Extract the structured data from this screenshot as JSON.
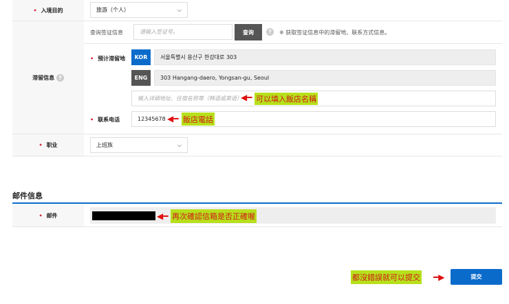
{
  "entry_purpose": {
    "label": "入境目的",
    "value": "旅游（个人）"
  },
  "stay_info": {
    "label": "滞留信息",
    "visa_query": {
      "label": "查询签证信息",
      "placeholder": "请输入签证号。",
      "button": "查询",
      "hint": "※ 获取签证信息中的滞留地、联系方式信息。"
    },
    "address": {
      "label": "预计滞留地",
      "kor_tag": "KOR",
      "kor_value": "서울특별시 용산구 한강대로 303",
      "eng_tag": "ENG",
      "eng_value": "303 Hangang-daero, Yongsan-gu, Seoul",
      "detail_placeholder": "输入详细地址、住宿名称等（韩语或英语）"
    },
    "phone": {
      "label": "联系电话",
      "value": "12345678"
    }
  },
  "occupation": {
    "label": "职业",
    "value": "上班族"
  },
  "mail_section": {
    "title": "邮件信息",
    "label": "邮件"
  },
  "submit": {
    "label": "提交"
  },
  "annotations": {
    "hotel_name": "可以填入飯店名稱",
    "hotel_phone": "飯店電話",
    "email_check": "再次確認信箱是否正確喔",
    "submit_note": "都沒錯誤就可以提交"
  },
  "colors": {
    "blue": "#0b6bcb",
    "dark": "#555555",
    "required": "#d0243a"
  }
}
